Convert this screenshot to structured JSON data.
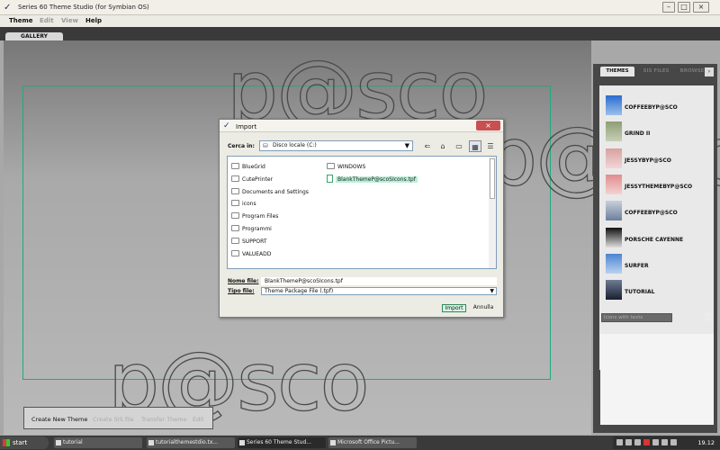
{
  "window": {
    "title": "Series 60 Theme Studio (for Symbian OS)",
    "controls": {
      "minimize": "–",
      "maximize": "□",
      "close": "×"
    }
  },
  "menu": {
    "items": [
      {
        "label": "Theme",
        "enabled": true
      },
      {
        "label": "Edit",
        "enabled": false
      },
      {
        "label": "View",
        "enabled": false
      },
      {
        "label": "Help",
        "enabled": true
      }
    ]
  },
  "gallery": {
    "tab_label": "GALLERY"
  },
  "watermark": {
    "text": "p@sco"
  },
  "bottom_bar": {
    "buttons": [
      {
        "label": "Create New Theme",
        "enabled": true
      },
      {
        "label": "Create SIS file",
        "enabled": false
      },
      {
        "label": "Transfer Theme",
        "enabled": false
      },
      {
        "label": "Edit",
        "enabled": false
      }
    ]
  },
  "side_panel": {
    "tabs": [
      {
        "label": "THEMES",
        "active": true
      },
      {
        "label": "SIS FILES",
        "active": false
      },
      {
        "label": "BROWSE",
        "active": false
      }
    ],
    "themes": [
      {
        "name": "COFFEEBYP@SCO",
        "colors": [
          "#2a6bd0",
          "#9ac0ea"
        ]
      },
      {
        "name": "GRIND II",
        "colors": [
          "#8e9e76",
          "#c6cfb6"
        ]
      },
      {
        "name": "JESSYBYP@SCO",
        "colors": [
          "#d9a0a0",
          "#f1d6d6"
        ]
      },
      {
        "name": "JESSYTHEMEBYP@SCO",
        "colors": [
          "#e08c8c",
          "#f4d2d2"
        ]
      },
      {
        "name": "COFFEEBYP@SCO",
        "colors": [
          "#c8d0dc",
          "#6d7f9c"
        ]
      },
      {
        "name": "PORSCHE CAYENNE",
        "colors": [
          "#111111",
          "#dddddd"
        ]
      },
      {
        "name": "SURFER",
        "colors": [
          "#4a84d4",
          "#b8d2f0"
        ]
      },
      {
        "name": "TUTORIAL",
        "colors": [
          "#6e7c96",
          "#1a2030"
        ]
      }
    ],
    "view_select": "Icons with texts",
    "trash_icon": "trash-icon"
  },
  "dialog": {
    "title": "Import",
    "look_in_label": "Cerca in:",
    "look_in_value": "Disco locale (C:)",
    "folders_col1": [
      "BlueGrid",
      "CutePrinter",
      "Documents and Settings",
      "icons",
      "Program Files",
      "Programmi",
      "SUPPORT",
      "VALUEADD"
    ],
    "folders_col2": [
      "WINDOWS"
    ],
    "selected_file": "BlankThemeP@scoSIcons.tpf",
    "file_name_label": "Nome file:",
    "file_name_value": "BlankThemeP@scoSIcons.tpf",
    "file_type_label": "Tipo file:",
    "file_type_value": "Theme Package File (.tpf)",
    "import_label": "Import",
    "cancel_label": "Annulla"
  },
  "taskbar": {
    "start_label": "start",
    "tasks": [
      {
        "label": "tutorial",
        "active": false
      },
      {
        "label": "tutorialthemestdio.tx...",
        "active": false
      },
      {
        "label": "Series 60 Theme Stud...",
        "active": true
      },
      {
        "label": "Microsoft Office Pictu...",
        "active": false
      }
    ],
    "clock": "19.12"
  }
}
